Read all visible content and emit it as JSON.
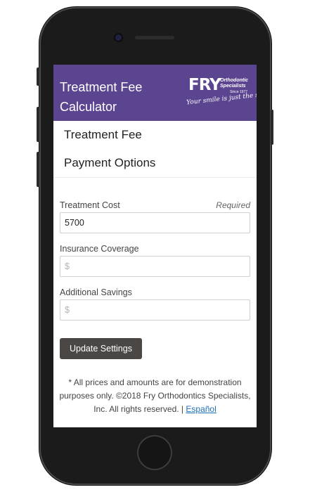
{
  "header": {
    "title": "Treatment Fee Calculator",
    "logo": {
      "brand": "FRY",
      "name": "Orthodontic Specialists",
      "since": "Since 1977",
      "tagline": "Your smile is just the start!"
    }
  },
  "nav": {
    "items": [
      {
        "label": "Treatment Fee"
      },
      {
        "label": "Payment Options"
      }
    ]
  },
  "form": {
    "treatment_cost": {
      "label": "Treatment Cost",
      "required": "Required",
      "value": "5700"
    },
    "insurance": {
      "label": "Insurance Coverage",
      "placeholder": "$"
    },
    "savings": {
      "label": "Additional Savings",
      "placeholder": "$"
    },
    "submit_label": "Update Settings"
  },
  "footer": {
    "text": "* All prices and amounts are for demonstration purposes only. ©2018 Fry Orthodontics Specialists, Inc. All rights reserved. |",
    "link": "Español"
  },
  "colors": {
    "header_bg": "#5b4591",
    "button_bg": "#4a4744",
    "link": "#1f6fb5"
  }
}
